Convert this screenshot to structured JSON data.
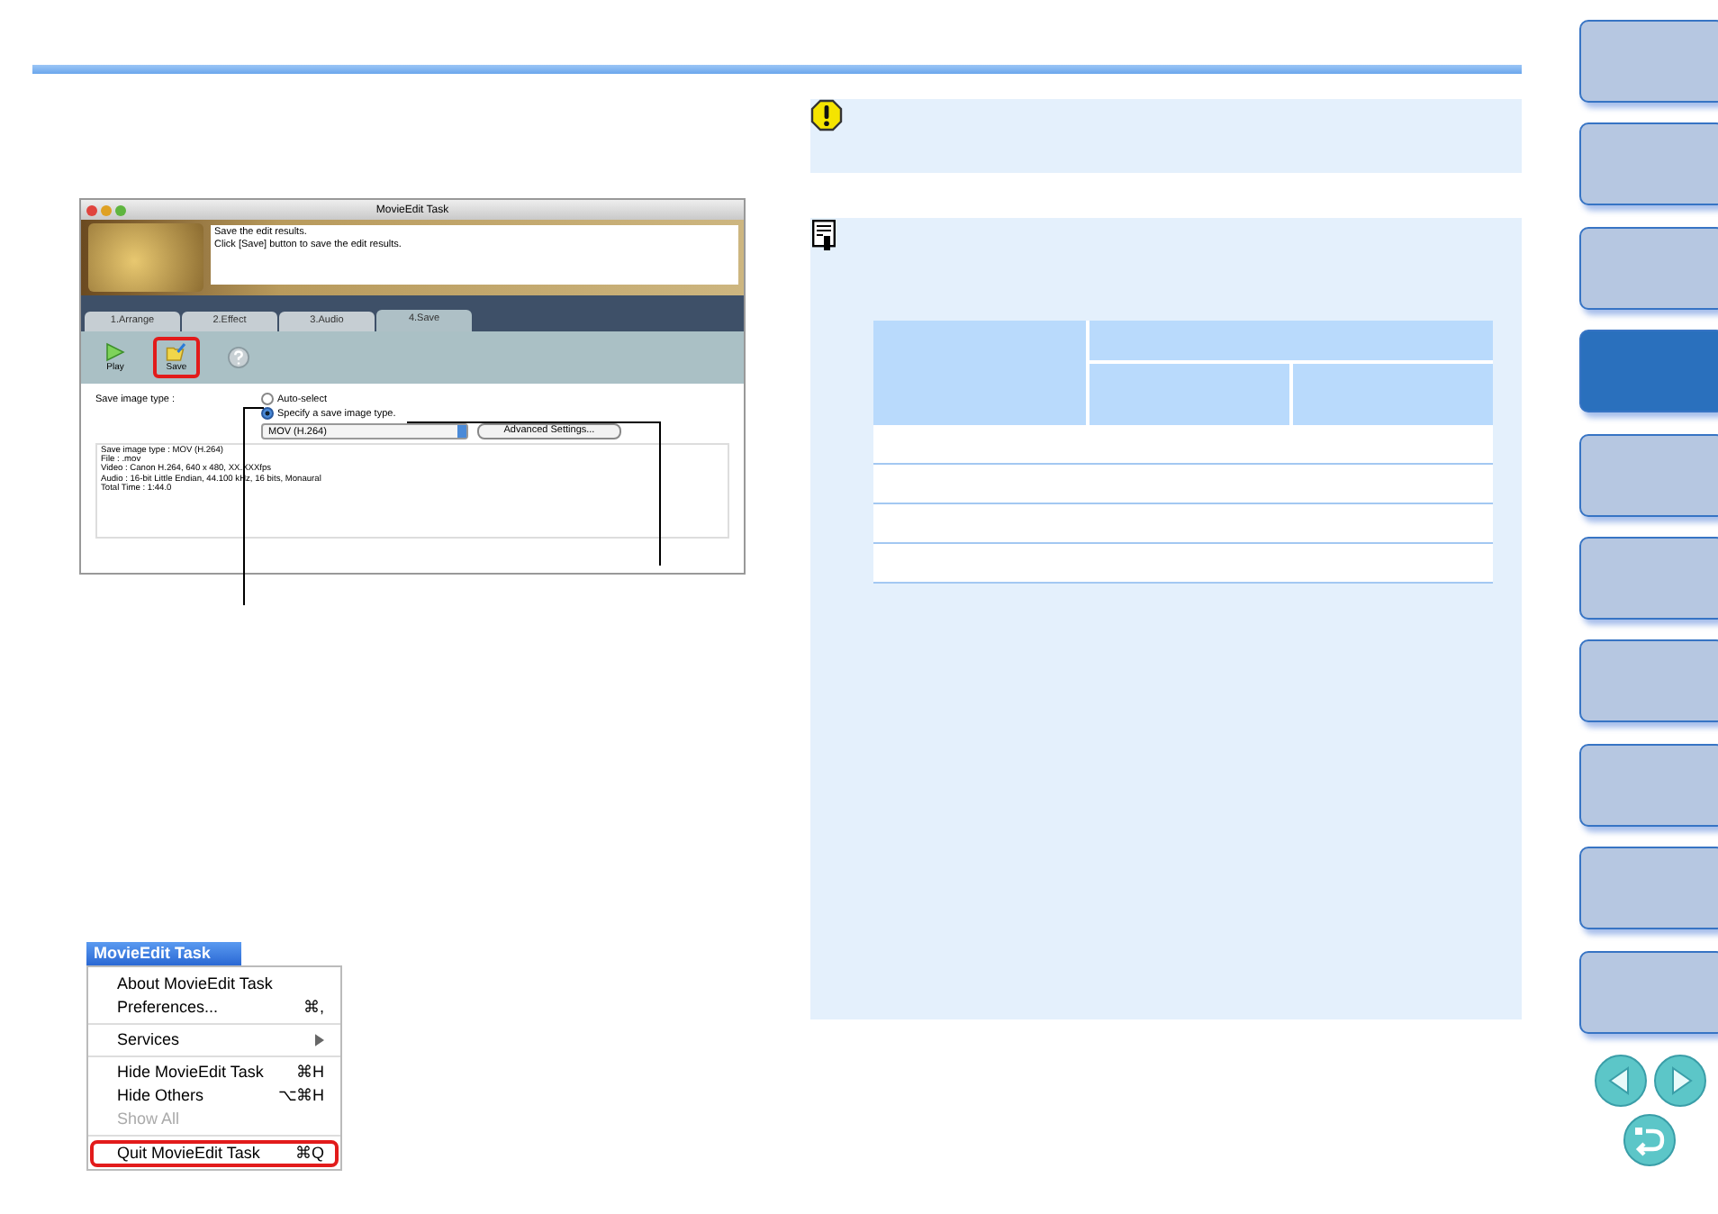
{
  "window": {
    "title": "MovieEdit Task",
    "instructions": [
      "Save the edit results.",
      "Click [Save] button to save the edit results."
    ],
    "tabs": [
      {
        "label": "1.Arrange",
        "selected": false
      },
      {
        "label": "2.Effect",
        "selected": false
      },
      {
        "label": "3.Audio",
        "selected": false
      },
      {
        "label": "4.Save",
        "selected": true
      }
    ],
    "toolbar": [
      {
        "kind": "play",
        "label": "Play",
        "callout": false
      },
      {
        "kind": "save",
        "label": "Save",
        "callout": true
      },
      {
        "kind": "help",
        "callout": false
      }
    ],
    "save_type_label": "Save image type :",
    "options": [
      {
        "label": "Auto-select",
        "selected": false
      },
      {
        "label": "Specify a save image type.",
        "selected": true
      }
    ],
    "format_dropdown": {
      "value": "MOV (H.264)"
    },
    "advanced_button": "Advanced Settings...",
    "info_lines": [
      "Save image type : MOV (H.264)",
      "File : .mov",
      "Video : Canon H.264, 640 x 480, XX.XXXfps",
      "Audio : 16-bit Little Endian, 44.100 kHz, 16 bits, Monaural",
      "Total Time : 1:44.0"
    ]
  },
  "app_menu": {
    "title": "MovieEdit Task",
    "groups": [
      [
        {
          "label": "About MovieEdit Task",
          "disabled": false,
          "callout": false
        },
        {
          "label": "Preferences...",
          "shortcut": "⌘,",
          "disabled": false,
          "callout": false
        }
      ],
      [
        {
          "label": "Services",
          "submenu": true,
          "disabled": false,
          "callout": false
        }
      ],
      [
        {
          "label": "Hide MovieEdit Task",
          "shortcut": "⌘H",
          "disabled": false,
          "callout": false
        },
        {
          "label": "Hide Others",
          "shortcut": "⌥⌘H",
          "disabled": false,
          "callout": false
        },
        {
          "label": "Show All",
          "disabled": true,
          "callout": false
        }
      ],
      [
        {
          "label": "Quit MovieEdit Task",
          "shortcut": "⌘Q",
          "disabled": false,
          "callout": true
        }
      ]
    ]
  },
  "side_tabs": [
    {
      "selected": false
    },
    {
      "selected": false
    },
    {
      "selected": false
    },
    {
      "selected": true
    },
    {
      "selected": false
    },
    {
      "selected": false
    },
    {
      "selected": false
    },
    {
      "selected": false
    },
    {
      "selected": false
    },
    {
      "selected": false
    }
  ]
}
